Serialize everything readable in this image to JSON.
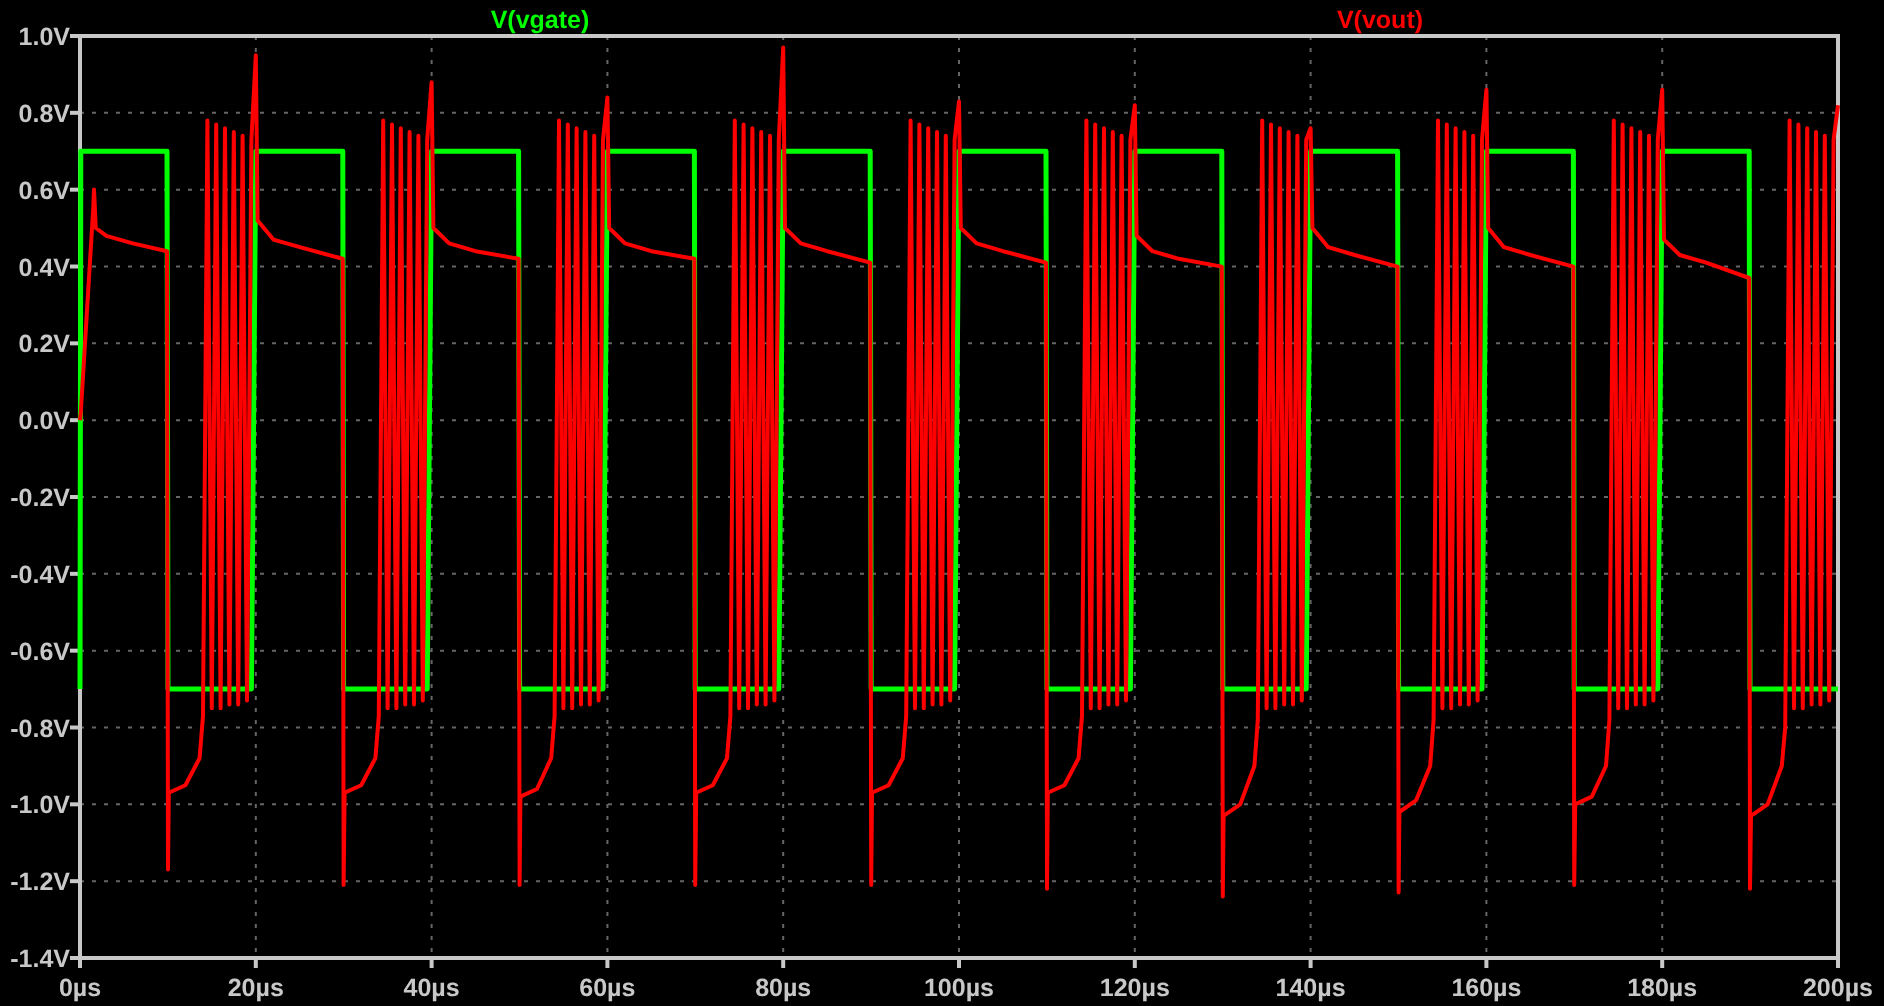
{
  "plot": {
    "chart_data": {
      "type": "line",
      "grid": true,
      "x": [
        0,
        0.1,
        1.5,
        1.6,
        1.8,
        3,
        6,
        9.9,
        10,
        10.1,
        12,
        13.6,
        14,
        14.5,
        15,
        15.5,
        16,
        16.5,
        17,
        17.5,
        18,
        18.5,
        19,
        19.5,
        20,
        20.2,
        22,
        25,
        29.9,
        30,
        30.1,
        32,
        33.6,
        34,
        34.5,
        35,
        35.5,
        36,
        36.5,
        37,
        37.5,
        38,
        38.5,
        39,
        39.5,
        40,
        40.2,
        42,
        45,
        49.9,
        50,
        50.1,
        52,
        53.6,
        54,
        54.5,
        55,
        55.5,
        56,
        56.5,
        57,
        57.5,
        58,
        58.5,
        59,
        59.5,
        60,
        60.2,
        62,
        65,
        69.9,
        70,
        70.1,
        72,
        73.6,
        74,
        74.5,
        75,
        75.5,
        76,
        76.5,
        77,
        77.5,
        78,
        78.5,
        79,
        79.5,
        80,
        80.2,
        82,
        85,
        89.9,
        90,
        90.1,
        92,
        93.6,
        94,
        94.5,
        95,
        95.5,
        96,
        96.5,
        97,
        97.5,
        98,
        98.5,
        99,
        99.5,
        100,
        100.2,
        102,
        105,
        109.9,
        110,
        110.1,
        112,
        113.6,
        114,
        114.5,
        115,
        115.5,
        116,
        116.5,
        117,
        117.5,
        118,
        118.5,
        119,
        119.5,
        120,
        120.2,
        122,
        125,
        129.9,
        130,
        130.1,
        132,
        133.6,
        134,
        134.5,
        135,
        135.5,
        136,
        136.5,
        137,
        137.5,
        138,
        138.5,
        139,
        139.5,
        140,
        140.2,
        142,
        145,
        149.9,
        150,
        150.1,
        152,
        153.6,
        154,
        154.5,
        155,
        155.5,
        156,
        156.5,
        157,
        157.5,
        158,
        158.5,
        159,
        159.5,
        160,
        160.2,
        162,
        165,
        169.9,
        170,
        170.1,
        172,
        173.6,
        174,
        174.5,
        175,
        175.5,
        176,
        176.5,
        177,
        177.5,
        178,
        178.5,
        179,
        179.5,
        180,
        180.2,
        182,
        185,
        189.9,
        190,
        190.1,
        192,
        193.6,
        194,
        194.5,
        195,
        195.5,
        196,
        196.5,
        197,
        197.5,
        198,
        198.5,
        199,
        199.5,
        200
      ],
      "series": [
        {
          "name": "V(vgate)",
          "color": "#00ff00",
          "values": [
            -0.7,
            0.7,
            0.7,
            0.7,
            0.7,
            0.7,
            0.7,
            0.7,
            -0.7,
            -0.7,
            -0.7,
            -0.7,
            -0.7,
            -0.7,
            -0.7,
            -0.7,
            -0.7,
            -0.7,
            -0.7,
            -0.7,
            -0.7,
            -0.7,
            -0.7,
            -0.7,
            0.7,
            0.7,
            0.7,
            0.7,
            0.7,
            -0.7,
            -0.7,
            -0.7,
            -0.7,
            -0.7,
            -0.7,
            -0.7,
            -0.7,
            -0.7,
            -0.7,
            -0.7,
            -0.7,
            -0.7,
            -0.7,
            -0.7,
            -0.7,
            0.7,
            0.7,
            0.7,
            0.7,
            0.7,
            -0.7,
            -0.7,
            -0.7,
            -0.7,
            -0.7,
            -0.7,
            -0.7,
            -0.7,
            -0.7,
            -0.7,
            -0.7,
            -0.7,
            -0.7,
            -0.7,
            -0.7,
            -0.7,
            0.7,
            0.7,
            0.7,
            0.7,
            0.7,
            -0.7,
            -0.7,
            -0.7,
            -0.7,
            -0.7,
            -0.7,
            -0.7,
            -0.7,
            -0.7,
            -0.7,
            -0.7,
            -0.7,
            -0.7,
            -0.7,
            -0.7,
            -0.7,
            0.7,
            0.7,
            0.7,
            0.7,
            0.7,
            -0.7,
            -0.7,
            -0.7,
            -0.7,
            -0.7,
            -0.7,
            -0.7,
            -0.7,
            -0.7,
            -0.7,
            -0.7,
            -0.7,
            -0.7,
            -0.7,
            -0.7,
            -0.7,
            0.7,
            0.7,
            0.7,
            0.7,
            0.7,
            -0.7,
            -0.7,
            -0.7,
            -0.7,
            -0.7,
            -0.7,
            -0.7,
            -0.7,
            -0.7,
            -0.7,
            -0.7,
            -0.7,
            -0.7,
            -0.7,
            -0.7,
            -0.7,
            0.7,
            0.7,
            0.7,
            0.7,
            0.7,
            -0.7,
            -0.7,
            -0.7,
            -0.7,
            -0.7,
            -0.7,
            -0.7,
            -0.7,
            -0.7,
            -0.7,
            -0.7,
            -0.7,
            -0.7,
            -0.7,
            -0.7,
            -0.7,
            0.7,
            0.7,
            0.7,
            0.7,
            0.7,
            -0.7,
            -0.7,
            -0.7,
            -0.7,
            -0.7,
            -0.7,
            -0.7,
            -0.7,
            -0.7,
            -0.7,
            -0.7,
            -0.7,
            -0.7,
            -0.7,
            -0.7,
            -0.7,
            0.7,
            0.7,
            0.7,
            0.7,
            0.7,
            -0.7,
            -0.7,
            -0.7,
            -0.7,
            -0.7,
            -0.7,
            -0.7,
            -0.7,
            -0.7,
            -0.7,
            -0.7,
            -0.7,
            -0.7,
            -0.7,
            -0.7,
            -0.7,
            0.7,
            0.7,
            0.7,
            0.7,
            0.7,
            -0.7,
            -0.7,
            -0.7,
            -0.7,
            -0.7,
            -0.7,
            -0.7,
            -0.7,
            -0.7,
            -0.7,
            -0.7,
            -0.7,
            -0.7,
            -0.7,
            -0.7,
            -0.7,
            -0.7
          ]
        },
        {
          "name": "V(vout)",
          "color": "#ff0000",
          "values": [
            0,
            0.02,
            0.55,
            0.6,
            0.5,
            0.48,
            0.46,
            0.44,
            -1.17,
            -0.97,
            -0.95,
            -0.88,
            -0.77,
            0.78,
            -0.75,
            0.77,
            -0.75,
            0.76,
            -0.74,
            0.75,
            -0.74,
            0.74,
            -0.73,
            0.73,
            0.95,
            0.52,
            0.47,
            0.45,
            0.42,
            -1.21,
            -0.97,
            -0.95,
            -0.88,
            -0.77,
            0.78,
            -0.75,
            0.77,
            -0.75,
            0.76,
            -0.74,
            0.75,
            -0.74,
            0.74,
            -0.73,
            0.73,
            0.88,
            0.5,
            0.46,
            0.44,
            0.42,
            -1.21,
            -0.98,
            -0.96,
            -0.88,
            -0.77,
            0.78,
            -0.75,
            0.77,
            -0.75,
            0.76,
            -0.74,
            0.75,
            -0.74,
            0.74,
            -0.73,
            0.73,
            0.84,
            0.5,
            0.46,
            0.44,
            0.42,
            -1.21,
            -0.97,
            -0.95,
            -0.88,
            -0.77,
            0.78,
            -0.75,
            0.77,
            -0.75,
            0.76,
            -0.74,
            0.75,
            -0.74,
            0.74,
            -0.73,
            0.73,
            0.97,
            0.5,
            0.46,
            0.44,
            0.41,
            -1.21,
            -0.97,
            -0.95,
            -0.88,
            -0.77,
            0.78,
            -0.75,
            0.77,
            -0.75,
            0.76,
            -0.74,
            0.75,
            -0.74,
            0.74,
            -0.73,
            0.73,
            0.83,
            0.5,
            0.46,
            0.44,
            0.41,
            -1.22,
            -0.97,
            -0.95,
            -0.88,
            -0.77,
            0.78,
            -0.75,
            0.77,
            -0.75,
            0.76,
            -0.74,
            0.75,
            -0.74,
            0.74,
            -0.73,
            0.73,
            0.82,
            0.48,
            0.44,
            0.42,
            0.4,
            -1.24,
            -1.03,
            -1,
            -0.9,
            -0.78,
            0.78,
            -0.75,
            0.77,
            -0.75,
            0.76,
            -0.74,
            0.75,
            -0.74,
            0.74,
            -0.73,
            0.73,
            0.76,
            0.5,
            0.45,
            0.43,
            0.4,
            -1.23,
            -1.02,
            -0.99,
            -0.9,
            -0.78,
            0.78,
            -0.75,
            0.77,
            -0.75,
            0.76,
            -0.74,
            0.75,
            -0.74,
            0.74,
            -0.73,
            0.73,
            0.86,
            0.5,
            0.45,
            0.43,
            0.4,
            -1.21,
            -1,
            -0.98,
            -0.9,
            -0.78,
            0.78,
            -0.75,
            0.77,
            -0.75,
            0.76,
            -0.74,
            0.75,
            -0.74,
            0.74,
            -0.73,
            0.73,
            0.86,
            0.47,
            0.43,
            0.41,
            0.37,
            -1.22,
            -1.03,
            -1,
            -0.9,
            -0.8,
            0.78,
            -0.75,
            0.77,
            -0.75,
            0.76,
            -0.74,
            0.75,
            -0.74,
            0.74,
            -0.73,
            0.73,
            0.82
          ]
        }
      ],
      "xlim": [
        0,
        200
      ],
      "ylim": [
        -1.4,
        1.0
      ],
      "xticks": [
        {
          "value": 0,
          "label": "0µs"
        },
        {
          "value": 20,
          "label": "20µs"
        },
        {
          "value": 40,
          "label": "40µs"
        },
        {
          "value": 60,
          "label": "60µs"
        },
        {
          "value": 80,
          "label": "80µs"
        },
        {
          "value": 100,
          "label": "100µs"
        },
        {
          "value": 120,
          "label": "120µs"
        },
        {
          "value": 140,
          "label": "140µs"
        },
        {
          "value": 160,
          "label": "160µs"
        },
        {
          "value": 180,
          "label": "180µs"
        },
        {
          "value": 200,
          "label": "200µs"
        }
      ],
      "yticks": [
        {
          "value": 1.0,
          "label": "1.0V"
        },
        {
          "value": 0.8,
          "label": "0.8V"
        },
        {
          "value": 0.6,
          "label": "0.6V"
        },
        {
          "value": 0.4,
          "label": "0.4V"
        },
        {
          "value": 0.2,
          "label": "0.2V"
        },
        {
          "value": 0,
          "label": "0.0V"
        },
        {
          "value": -0.2,
          "label": "-0.2V"
        },
        {
          "value": -0.4,
          "label": "-0.4V"
        },
        {
          "value": -0.6,
          "label": "-0.6V"
        },
        {
          "value": -0.8,
          "label": "-0.8V"
        },
        {
          "value": -1.0,
          "label": "-1.0V"
        },
        {
          "value": -1.2,
          "label": "-1.2V"
        },
        {
          "value": -1.4,
          "label": "-1.4V"
        }
      ]
    }
  }
}
